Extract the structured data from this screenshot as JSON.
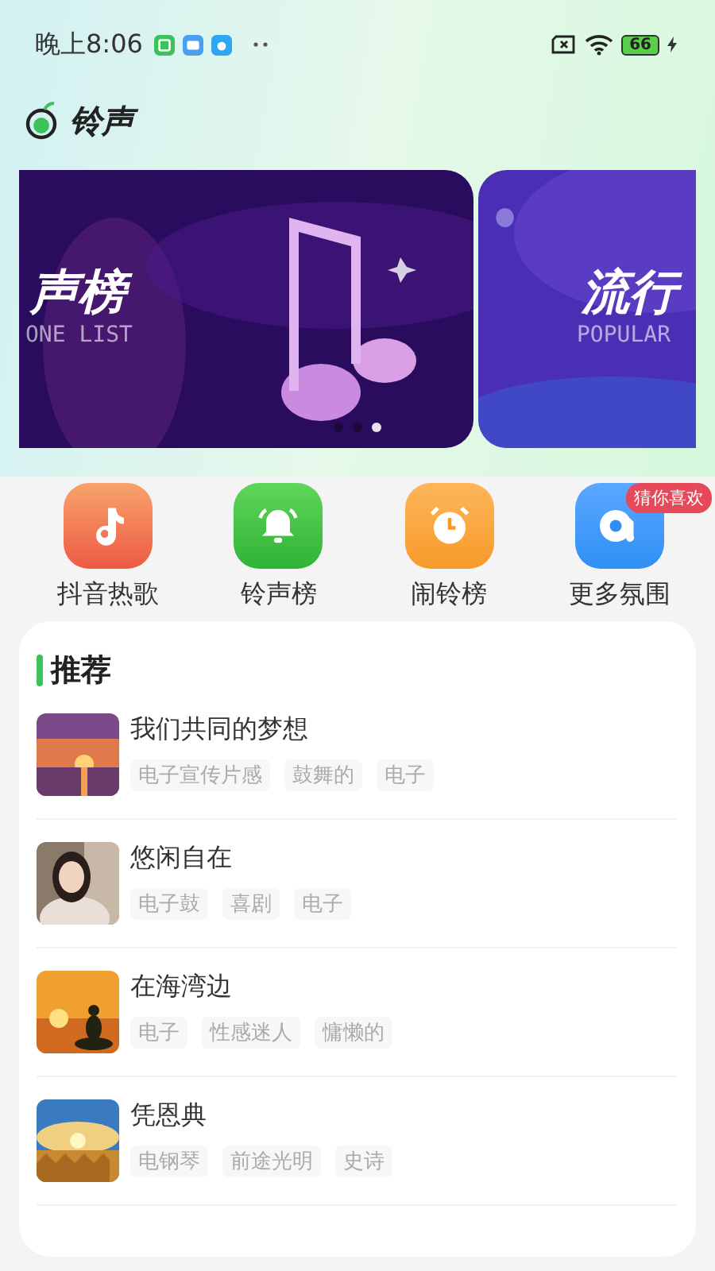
{
  "status_bar": {
    "time": "晚上8:06",
    "battery": "66"
  },
  "header": {
    "title": "铃声"
  },
  "banners": [
    {
      "title": "声榜",
      "subtitle": "ONE LIST"
    },
    {
      "title": "流行",
      "subtitle": "POPULAR"
    }
  ],
  "banner_dots": [
    {
      "selected": false
    },
    {
      "selected": false
    },
    {
      "selected": true
    }
  ],
  "shortcuts": [
    {
      "kind": "music",
      "label": "抖音热歌"
    },
    {
      "kind": "bell",
      "label": "铃声榜"
    },
    {
      "kind": "alarm",
      "label": "闹铃榜"
    },
    {
      "kind": "atmosphere",
      "label": "更多氛围",
      "badge": "猜你喜欢"
    }
  ],
  "recommend": {
    "title": "推荐",
    "items": [
      {
        "title": "我们共同的梦想",
        "tags": [
          "电子宣传片感",
          "鼓舞的",
          "电子"
        ]
      },
      {
        "title": "悠闲自在",
        "tags": [
          "电子鼓",
          "喜剧",
          "电子"
        ]
      },
      {
        "title": "在海湾边",
        "tags": [
          "电子",
          "性感迷人",
          "慵懒的"
        ]
      },
      {
        "title": "凭恩典",
        "tags": [
          "电钢琴",
          "前途光明",
          "史诗"
        ]
      }
    ]
  }
}
